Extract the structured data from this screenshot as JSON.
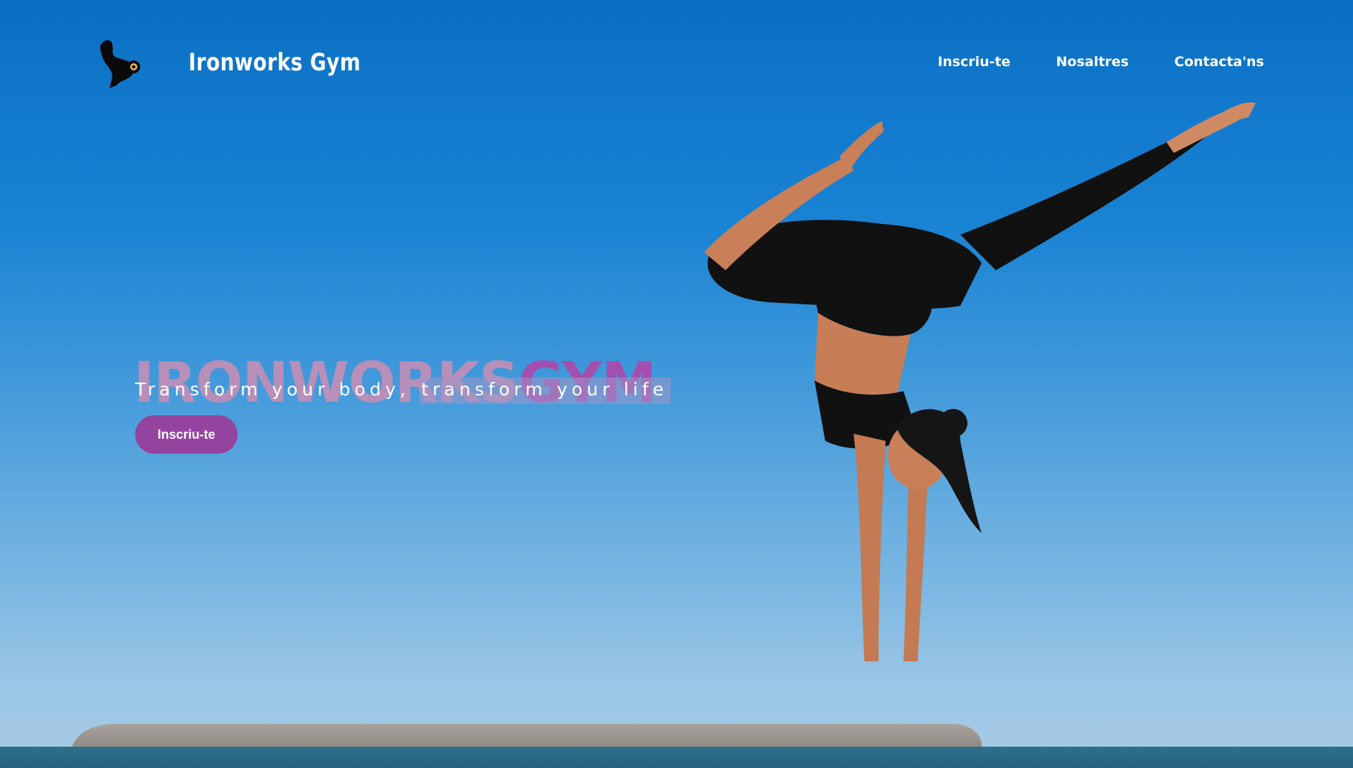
{
  "header": {
    "brand": "Ironworks Gym",
    "logo_icon": "bodybuilder-dumbbell-icon",
    "nav": [
      {
        "label": "Inscriu-te"
      },
      {
        "label": "Nosaltres"
      },
      {
        "label": "Contacta'ns"
      }
    ]
  },
  "hero": {
    "headline_part1": "IRONWORKS",
    "headline_part2": "GYM",
    "tagline_part1": "Transform your body, ",
    "tagline_part2": "transform your life",
    "cta_label": "Inscriu-te"
  },
  "colors": {
    "headline_light": "#b78fb9",
    "headline_accent": "#a24fb0",
    "cta_background": "#94449f",
    "nav_text": "#ffffff"
  }
}
